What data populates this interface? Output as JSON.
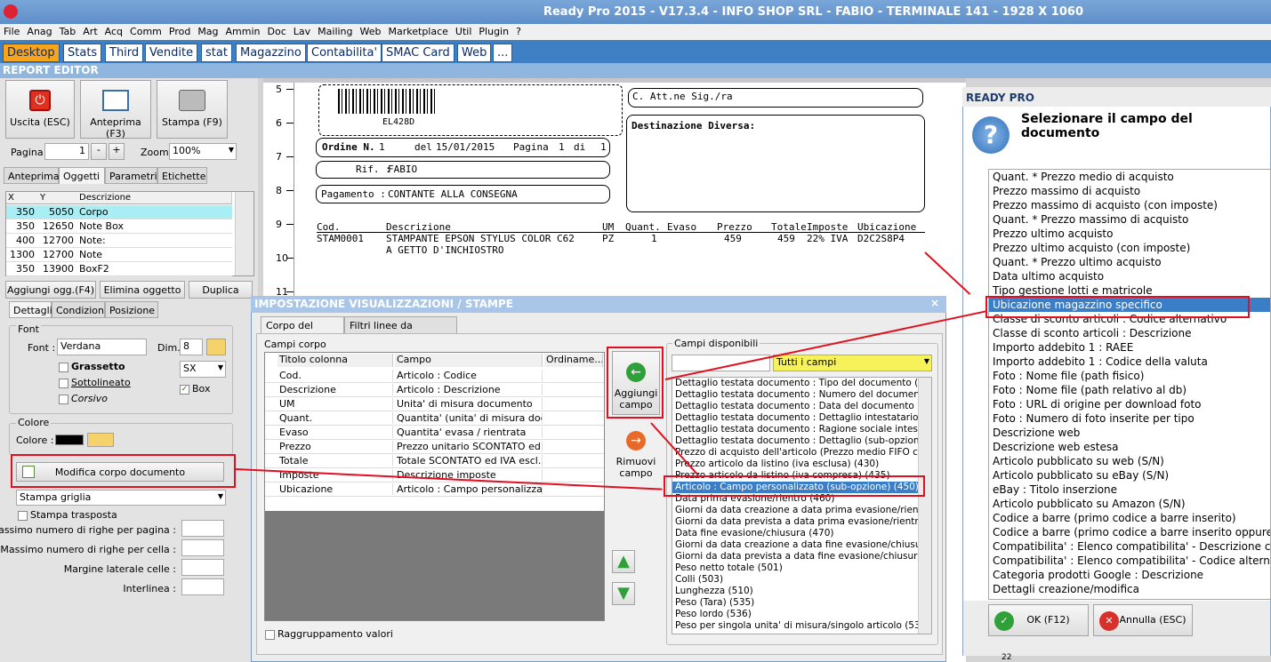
{
  "window": {
    "title": "Ready Pro 2015 - V17.3.4 - INFO SHOP SRL - FABIO - TERMINALE 141 - 1928 X 1060"
  },
  "menu": [
    "File",
    "Anag",
    "Tab",
    "Art",
    "Acq",
    "Comm",
    "Prod",
    "Mag",
    "Ammin",
    "Doc",
    "Lav",
    "Mailing",
    "Web",
    "Marketplace",
    "Util",
    "Plugin",
    "?"
  ],
  "tabs": [
    "Desktop",
    "Stats",
    "Third",
    "Vendite",
    "stat",
    "Magazzino",
    "Contabilita'",
    "SMAC Card",
    "Web",
    "..."
  ],
  "report_editor": {
    "title": "REPORT EDITOR",
    "buttons": {
      "exit": "Uscita (ESC)",
      "preview": "Anteprima (F3)",
      "print": "Stampa (F9)"
    },
    "page_label": "Pagina",
    "page_value": "1",
    "minus": "-",
    "plus": "+",
    "zoom_label": "Zoom",
    "zoom_value": "100%",
    "subtabs": [
      "Anteprima",
      "Oggetti",
      "Parametri",
      "Etichette"
    ],
    "grid": {
      "headers": [
        "X",
        "Y",
        "Descrizione"
      ],
      "rows": [
        [
          "350",
          "5050",
          "Corpo"
        ],
        [
          "350",
          "12650",
          "Note Box"
        ],
        [
          "400",
          "12700",
          "Note:"
        ],
        [
          "1300",
          "12700",
          "Note"
        ],
        [
          "350",
          "13900",
          "BoxF2"
        ]
      ]
    },
    "obj_buttons": {
      "add": "Aggiungi ogg.(F4)",
      "delete": "Elimina oggetto",
      "duplicate": "Duplica"
    },
    "detail_tabs": [
      "Dettagli",
      "Condizioni",
      "Posizione"
    ],
    "font": {
      "group": "Font",
      "font_label": "Font :",
      "font_value": "Verdana",
      "dim_label": "Dim.",
      "dim_value": "8",
      "bold": "Grassetto",
      "underline": "Sottolineato",
      "italic": "Corsivo",
      "align_value": "SX",
      "box": "Box"
    },
    "color": {
      "group": "Colore",
      "color_label": "Colore :"
    },
    "edit_body_button": "Modifica corpo documento",
    "print_grid_value": "Stampa griglia",
    "transposed": "Stampa trasposta",
    "params": [
      "Massimo numero di righe per pagina :",
      "Massimo numero di righe per cella :",
      "Margine laterale celle :",
      "Interlinea :"
    ]
  },
  "document": {
    "ruler": [
      "5",
      "6",
      "7",
      "8",
      "9",
      "10",
      "11"
    ],
    "barcode_text": "EL428D",
    "att": "C. Att.ne Sig./ra",
    "dest_label": "Destinazione Diversa:",
    "order_label": "Ordine N.",
    "order_no": "1",
    "date_label": "del",
    "date": "15/01/2015",
    "page_label": "Pagina",
    "page_no": "1",
    "of_label": "di",
    "of_no": "1",
    "rif_label": "Rif. :",
    "rif_value": "FABIO",
    "pay_label": "Pagamento :",
    "pay_value": "CONTANTE ALLA CONSEGNA",
    "headers": [
      "Cod.",
      "Descrizione",
      "UM",
      "Quant.",
      "Evaso",
      "Prezzo",
      "Totale",
      "Imposte",
      "Ubicazione"
    ],
    "row": [
      "STAM0001",
      "STAMPANTE EPSON STYLUS COLOR C62",
      "PZ",
      "1",
      "",
      "459",
      "459",
      "22% IVA",
      "D2C2S8P4"
    ],
    "row_cont": "A GETTO D'INCHIOSTRO"
  },
  "dialog": {
    "title": "IMPOSTAZIONE VISUALIZZAZIONI / STAMPE",
    "close": "×",
    "tabs": [
      "Corpo del report",
      "Filtri linee da visualizzare"
    ],
    "body_group": "Campi corpo",
    "body_headers": [
      "Titolo colonna",
      "Campo",
      "Ordiname..."
    ],
    "body_rows": [
      [
        "Cod.",
        "Articolo : Codice"
      ],
      [
        "Descrizione",
        "Articolo : Descrizione"
      ],
      [
        "UM",
        "Unita' di misura documento"
      ],
      [
        "Quant.",
        "Quantita' (unita' di misura docu..."
      ],
      [
        "Evaso",
        "Quantita' evasa / rientrata"
      ],
      [
        "Prezzo",
        "Prezzo unitario SCONTATO ed ..."
      ],
      [
        "Totale",
        "Totale SCONTATO ed IVA escl..."
      ],
      [
        "Imposte",
        "Descrizione imposte"
      ],
      [
        "Ubicazione",
        "Articolo : Campo personalizzat..."
      ]
    ],
    "add_button": "Aggiungi campo",
    "remove_button": "Rimuovi campo",
    "group_values": "Raggruppamento valori",
    "avail_group": "Campi disponibili",
    "avail_filter": "Tutti i campi",
    "avail_items": [
      "Dettaglio testata documento : Tipo del documento (descr",
      "Dettaglio testata documento : Numero del documento (39",
      "Dettaglio testata documento : Data del documento (396)",
      "Dettaglio testata documento : Dettaglio intestatario (sub",
      "Dettaglio testata documento : Ragione sociale intestatari",
      "Dettaglio testata documento : Dettaglio (sub-opzione) (3",
      "Prezzo di acquisto dell'articolo (Prezzo medio FIFO calcola",
      "Prezzo articolo da listino (iva esclusa) (430)",
      "Prezzo articolo da listino (iva compresa) (435)",
      "Articolo : Campo personalizzato (sub-opzione) (450)",
      "Data prima evasione/rientro (460)",
      "Giorni da data creazione a data prima evasione/rientro (4",
      "Giorni da data prevista a data prima evasione/rientro (46",
      "Data fine evasione/chiusura (470)",
      "Giorni da data creazione a data fine evasione/chiusura (4",
      "Giorni da data prevista a data fine evasione/chiusura (47",
      "Peso netto totale (501)",
      "Colli (503)",
      "Lunghezza (510)",
      "Peso (Tara) (535)",
      "Peso lordo (536)",
      "Peso per singola unita' di misura/singolo articolo (537)"
    ]
  },
  "readypro": {
    "title": "READY PRO",
    "prompt": "Selezionare il campo del documento",
    "items": [
      "Quant. * Prezzo medio di acquisto",
      "Prezzo massimo di acquisto",
      "Prezzo massimo di acquisto (con imposte)",
      "Quant. * Prezzo massimo di acquisto",
      "Prezzo ultimo acquisto",
      "Prezzo ultimo acquisto (con imposte)",
      "Quant. * Prezzo ultimo acquisto",
      "Data ultimo acquisto",
      "Tipo gestione lotti e matricole",
      "Ubicazione magazzino specifico",
      "Classe di sconto articoli : Codice alternativo",
      "Classe di sconto articoli : Descrizione",
      "Importo addebito 1 : RAEE",
      "Importo addebito 1 : Codice della valuta",
      "Foto : Nome file (path fisico)",
      "Foto : Nome file (path relativo al db)",
      "Foto : URL di origine per download foto",
      "Foto : Numero di foto inserite per tipo",
      "Descrizione web",
      "Descrizione web estesa",
      "Articolo pubblicato su web (S/N)",
      "Articolo pubblicato su eBay (S/N)",
      "eBay : Titolo inserzione",
      "Articolo pubblicato su Amazon (S/N)",
      "Codice a barre (primo codice a barre inserito)",
      "Codice a barre (primo codice a barre inserito oppure c",
      "Compatibilita' : Elenco compatibilita' - Descrizione comp",
      "Compatibilita' : Elenco compatibilita' - Codice alternativ",
      "Categoria prodotti Google : Descrizione",
      "Dettagli creazione/modifica"
    ],
    "ok": "OK (F12)",
    "cancel": "Annulla (ESC)",
    "footer": "22"
  },
  "colors": {
    "accent": "#3b7ec8",
    "highlight": "#e01020",
    "tab_active": "#f8a51c"
  }
}
